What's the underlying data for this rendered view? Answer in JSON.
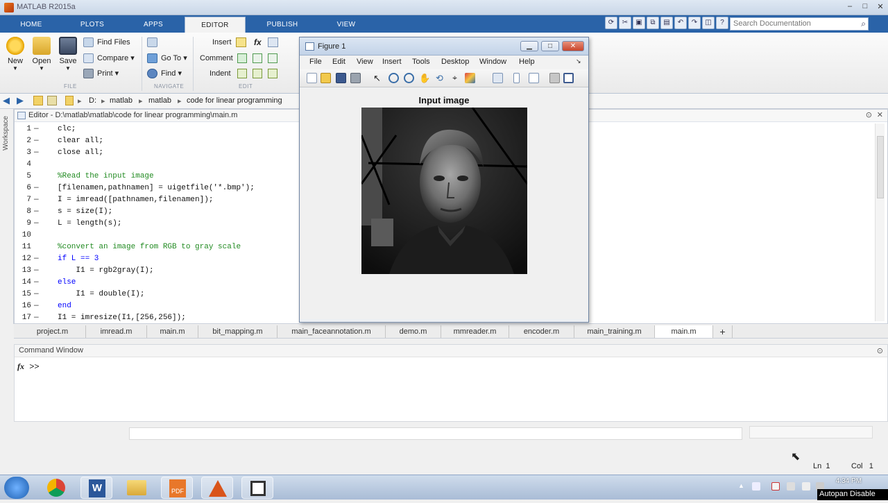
{
  "app": {
    "title": "MATLAB R2015a"
  },
  "tabs": [
    "HOME",
    "PLOTS",
    "APPS",
    "EDITOR",
    "PUBLISH",
    "VIEW"
  ],
  "active_tab": "EDITOR",
  "search": {
    "placeholder": "Search Documentation"
  },
  "ribbon": {
    "file": {
      "new": "New",
      "open": "Open",
      "save": "Save",
      "find_files": "Find Files",
      "compare": "Compare",
      "print": "Print",
      "label": "FILE"
    },
    "navigate": {
      "go_to": "Go To",
      "find": "Find",
      "label": "NAVIGATE"
    },
    "edit": {
      "insert": "Insert",
      "comment": "Comment",
      "indent": "Indent",
      "label": "EDIT",
      "fx": "fx"
    }
  },
  "address": {
    "drive": "D:",
    "crumbs": [
      "matlab",
      "matlab",
      "code for linear programming"
    ]
  },
  "editor": {
    "title": "Editor - D:\\matlab\\matlab\\code for linear programming\\main.m",
    "workspace_label": "Workspace",
    "lines": [
      {
        "num": "1",
        "text": "clc;",
        "type": "code"
      },
      {
        "num": "2",
        "text": "clear all;",
        "type": "code"
      },
      {
        "num": "3",
        "text": "close all;",
        "type": "code"
      },
      {
        "num": "4",
        "text": "",
        "type": "blank"
      },
      {
        "num": "5",
        "text": "%Read the input image",
        "type": "comment"
      },
      {
        "num": "6",
        "text": "[filenamen,pathnamen] = uigetfile('*.bmp');",
        "type": "code"
      },
      {
        "num": "7",
        "text": "I = imread([pathnamen,filenamen]);",
        "type": "code"
      },
      {
        "num": "8",
        "text": "s = size(I);",
        "type": "code"
      },
      {
        "num": "9",
        "text": "L = length(s);",
        "type": "code"
      },
      {
        "num": "10",
        "text": "",
        "type": "blank"
      },
      {
        "num": "11",
        "text": "%convert an image from RGB to gray scale",
        "type": "comment"
      },
      {
        "num": "12",
        "text": "if L == 3",
        "type": "kw"
      },
      {
        "num": "13",
        "text": "    I1 = rgb2gray(I);",
        "type": "code"
      },
      {
        "num": "14",
        "text": "else",
        "type": "kw"
      },
      {
        "num": "15",
        "text": "    I1 = double(I);",
        "type": "code"
      },
      {
        "num": "16",
        "text": "end",
        "type": "kw"
      },
      {
        "num": "17",
        "text": "I1 = imresize(I1,[256,256]);",
        "type": "code"
      }
    ]
  },
  "file_tabs": [
    "project.m",
    "imread.m",
    "main.m",
    "bit_mapping.m",
    "main_faceannotation.m",
    "demo.m",
    "mmreader.m",
    "encoder.m",
    "main_training.m",
    "main.m",
    "+"
  ],
  "active_file_tab": 9,
  "command_window": {
    "title": "Command Window",
    "prompt": ">>",
    "fx": "fx"
  },
  "status": {
    "ln_label": "Ln",
    "ln": "1",
    "col_label": "Col",
    "col": "1"
  },
  "figure": {
    "title": "Figure 1",
    "menu": [
      "File",
      "Edit",
      "View",
      "Insert",
      "Tools",
      "Desktop",
      "Window",
      "Help"
    ],
    "axes_title": "Input image"
  },
  "taskbar": {
    "clock": "4:34 PM",
    "autopan": "Autopan Disable"
  },
  "colors": {
    "ribbon_blue": "#2a63a8",
    "comment_green": "#228b22",
    "keyword_blue": "#0000ff"
  }
}
